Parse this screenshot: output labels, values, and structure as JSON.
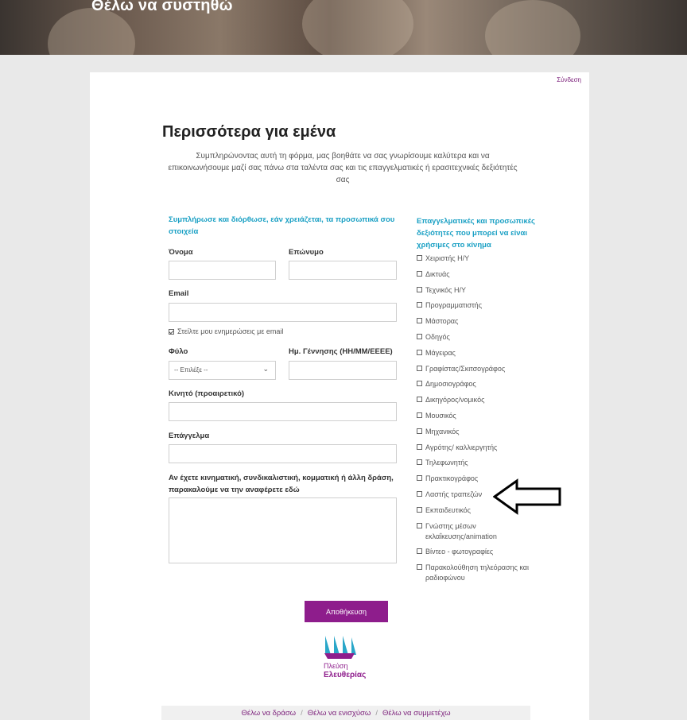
{
  "hero": {
    "title": "Θέλω να συστηθώ"
  },
  "header": {
    "login_label": "Σύνδεση"
  },
  "page": {
    "title": "Περισσότερα για εμένα",
    "intro_line1": "Συμπληρώνοντας αυτή τη φόρμα, μας βοηθάτε να σας γνωρίσουμε καλύτερα και να",
    "intro_line2": "επικοινωνήσουμε μαζί σας πάνω στα ταλέντα σας και τις επαγγελματικές ή ερασιτεχνικές δεξιότητές",
    "intro_line3": "σας"
  },
  "personal": {
    "heading_line1": "Συμπλήρωσε και διόρθωσε, εάν χρειάζεται, τα προσωπικά σου",
    "heading_line2": "στοιχεία",
    "first_name_label": "Όνομα",
    "last_name_label": "Επώνυμο",
    "email_label": "Email",
    "newsletter_label": "Στείλτε μου ενημερώσεις με email",
    "gender_label": "Φύλο",
    "gender_selected": "-- Επιλέξε --",
    "birthdate_label": "Ημ. Γέννησης (ΗΗ/ΜΜ/ΕΕΕΕ)",
    "mobile_label": "Κινητό (προαιρετικό)",
    "profession_label": "Επάγγελμα",
    "activity_label_line1": "Αν έχετε κινηματική, συνδικαλιστική, κομματική ή άλλη δράση,",
    "activity_label_line2": "παρακαλούμε να την αναφέρετε εδώ"
  },
  "skills": {
    "heading_line1": "Επαγγελματικές και προσωπικές",
    "heading_line2": "δεξιότητες που μπορεί να είναι",
    "heading_line3": "χρήσιμες στο κίνημα",
    "items": [
      "Χειριστής Η/Υ",
      "Δικτυάς",
      "Τεχνικός Η/Υ",
      "Προγραμματιστής",
      "Μάστορας",
      "Οδηγός",
      "Μάγειρας",
      "Γραφίστας/Σκιτσογράφος",
      "Δημοσιογράφος",
      "Δικηγόρος/νομικός",
      "Μουσικός",
      "Μηχανικός",
      "Αγρότης/ καλλιεργητής",
      "Τηλεφωνητής",
      "Πρακτικογράφος",
      "Λαστής τραπεζών",
      "Εκπαιδευτικός",
      "Γνώστης μέσων εκλαΐκευσης/animation",
      "Βίντεο - φωτογραφίες",
      "Παρακολούθηση τηλεόρασης και ραδιοφώνου"
    ]
  },
  "actions": {
    "save_label": "Αποθήκευση"
  },
  "logo": {
    "line1": "Πλεύση",
    "line2": "Ελευθερίας"
  },
  "footer": {
    "link1": "Θέλω να δράσω",
    "link2": "Θέλω να ενισχύσω",
    "link3": "Θέλω να συμμετέχω",
    "separator": "/"
  },
  "colors": {
    "accent": "#8e1d8c",
    "heading": "#1aa0c4"
  }
}
